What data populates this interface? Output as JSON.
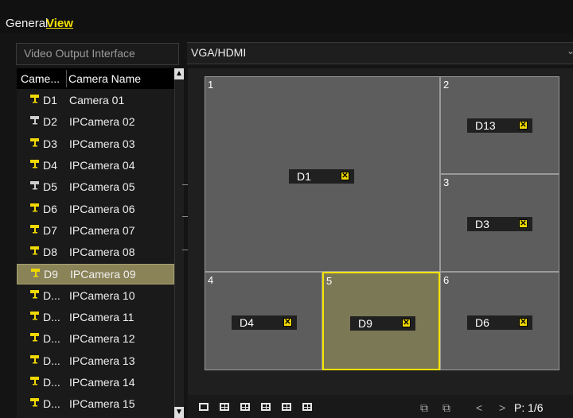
{
  "tabs": [
    {
      "label": "General",
      "active": false
    },
    {
      "label": "View",
      "active": true
    }
  ],
  "video_output": {
    "label": "Video Output Interface",
    "value": "VGA/HDMI"
  },
  "camera_list": {
    "headers": [
      "Came...",
      "Camera Name"
    ],
    "rows": [
      {
        "no": "D1",
        "name": "Camera 01",
        "icon": "camera-icon",
        "icon_color": "#f0d800"
      },
      {
        "no": "D2",
        "name": "IPCamera 02",
        "icon": "camera-icon",
        "icon_color": "#cccccc"
      },
      {
        "no": "D3",
        "name": "IPCamera 03",
        "icon": "camera-icon",
        "icon_color": "#f0d800"
      },
      {
        "no": "D4",
        "name": "IPCamera 04",
        "icon": "camera-icon",
        "icon_color": "#f0d800"
      },
      {
        "no": "D5",
        "name": "IPCamera 05",
        "icon": "camera-icon",
        "icon_color": "#cccccc"
      },
      {
        "no": "D6",
        "name": "IPCamera 06",
        "icon": "camera-icon",
        "icon_color": "#f0d800"
      },
      {
        "no": "D7",
        "name": "IPCamera 07",
        "icon": "camera-icon",
        "icon_color": "#f0d800"
      },
      {
        "no": "D8",
        "name": "IPCamera 08",
        "icon": "camera-icon",
        "icon_color": "#f0d800"
      },
      {
        "no": "D9",
        "name": "IPCamera 09",
        "icon": "camera-icon",
        "icon_color": "#f0d800",
        "selected": true
      },
      {
        "no": "D...",
        "name": "IPCamera 10",
        "icon": "camera-icon",
        "icon_color": "#f0d800"
      },
      {
        "no": "D...",
        "name": "IPCamera 11",
        "icon": "camera-icon",
        "icon_color": "#f0d800"
      },
      {
        "no": "D...",
        "name": "IPCamera 12",
        "icon": "camera-icon",
        "icon_color": "#f0d800"
      },
      {
        "no": "D...",
        "name": "IPCamera 13",
        "icon": "camera-icon",
        "icon_color": "#f0d800"
      },
      {
        "no": "D...",
        "name": "IPCamera 14",
        "icon": "camera-icon",
        "icon_color": "#f0d800"
      },
      {
        "no": "D...",
        "name": "IPCamera 15",
        "icon": "camera-icon",
        "icon_color": "#f0d800"
      }
    ]
  },
  "preview": {
    "windows": [
      {
        "num": "1",
        "camera": "D1"
      },
      {
        "num": "2",
        "camera": "D13"
      },
      {
        "num": "3",
        "camera": "D3"
      },
      {
        "num": "4",
        "camera": "D4"
      },
      {
        "num": "5",
        "camera": "D9",
        "selected": true
      },
      {
        "num": "6",
        "camera": "D6"
      }
    ],
    "remove_icon": "close-box-icon"
  },
  "toolbar": {
    "layout_icons": [
      "layout-1-icon",
      "layout-4-icon",
      "layout-6-icon",
      "layout-8-icon",
      "layout-9-icon",
      "layout-16-icon"
    ],
    "page_label": "P: 1/6",
    "prev_symbol": "<",
    "next_symbol": ">"
  },
  "colors": {
    "accent": "#f4e200",
    "selected_row": "#8a8358",
    "window_bg": "#5d5d5d"
  }
}
